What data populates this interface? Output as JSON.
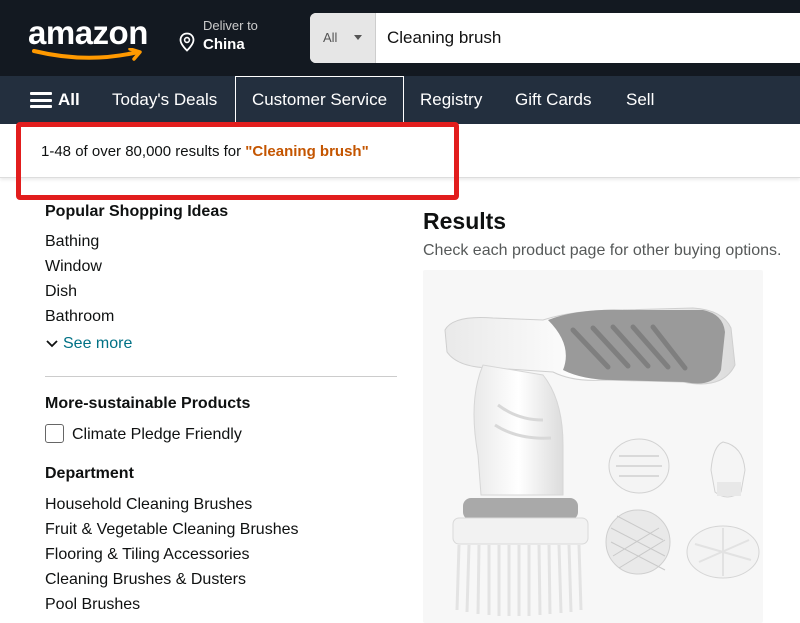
{
  "header": {
    "logo_text": "amazon",
    "deliver_line1": "Deliver to",
    "deliver_line2": "China",
    "search_dept": "All",
    "search_value": "Cleaning brush"
  },
  "nav": {
    "all": "All",
    "items": [
      "Today's Deals",
      "Customer Service",
      "Registry",
      "Gift Cards",
      "Sell"
    ]
  },
  "results_info": {
    "prefix": "1-48 of over 80,000 results for ",
    "term": "\"Cleaning brush\""
  },
  "sidebar": {
    "popular_heading": "Popular Shopping Ideas",
    "popular_items": [
      "Bathing",
      "Window",
      "Dish",
      "Bathroom"
    ],
    "see_more": "See more",
    "sustainable_heading": "More-sustainable Products",
    "sustainable_option": "Climate Pledge Friendly",
    "department_heading": "Department",
    "department_items": [
      "Household Cleaning Brushes",
      "Fruit & Vegetable Cleaning Brushes",
      "Flooring & Tiling Accessories",
      "Cleaning Brushes & Dusters",
      "Pool Brushes"
    ]
  },
  "results": {
    "title": "Results",
    "subtitle": "Check each product page for other buying options."
  },
  "colors": {
    "header_bg": "#131921",
    "nav_bg": "#232f3e",
    "accent_orange": "#ff9900",
    "search_term": "#c45500",
    "link_teal": "#007185",
    "highlight_red": "#e21d1d"
  },
  "icons": [
    "location-pin-icon",
    "caret-down-icon",
    "hamburger-icon",
    "chevron-down-icon",
    "checkbox-icon"
  ]
}
